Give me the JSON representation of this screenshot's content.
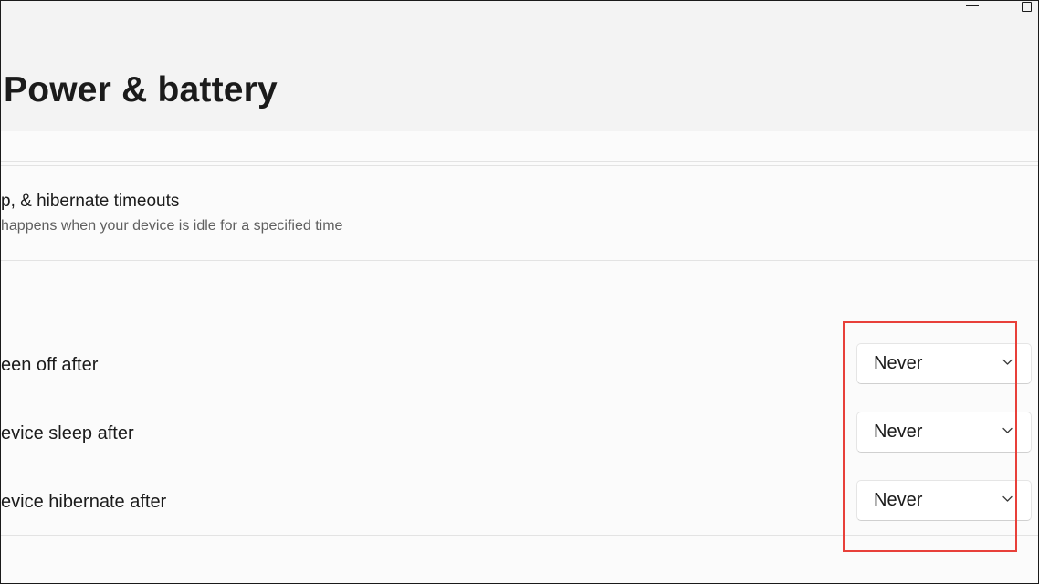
{
  "window": {
    "title": "Power & battery"
  },
  "section": {
    "title": "p, & hibernate timeouts",
    "subtitle": "happens when your device is idle for a specified time"
  },
  "settings": [
    {
      "label": "een off after",
      "value": "Never"
    },
    {
      "label": "evice sleep after",
      "value": "Never"
    },
    {
      "label": "evice hibernate after",
      "value": "Never"
    }
  ],
  "icons": {
    "minimize": "minimize-icon",
    "maximize": "maximize-icon",
    "dropdown": "chevron-down-icon"
  },
  "colors": {
    "header_bg": "#f3f3f3",
    "content_bg": "#fbfbfb",
    "highlight": "#e8403a",
    "text_secondary": "#5f5f5f"
  }
}
